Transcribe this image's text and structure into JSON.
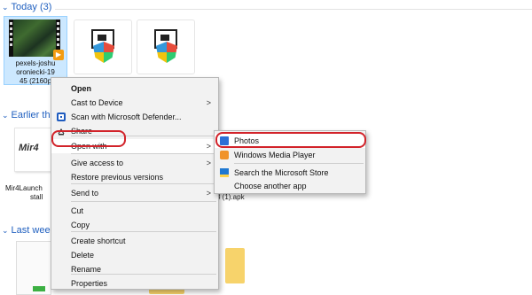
{
  "groups": [
    {
      "label": "Today (3)"
    },
    {
      "label": "Earlier this"
    },
    {
      "label": "Last week"
    }
  ],
  "files": {
    "video": {
      "caption_lines": [
        "pexels-joshu",
        "oroniecki-19",
        "45 (2160p"
      ]
    },
    "installer_caption_tail": "stall",
    "mir4": {
      "caption_lines": [
        "Mir4Launch",
        "stall"
      ],
      "logo_text": "Mir4"
    },
    "apk_suffix": "8 (1).apk"
  },
  "context_menu": {
    "items": [
      {
        "label": "Open",
        "bold": true
      },
      {
        "label": "Cast to Device",
        "arrow": true
      },
      {
        "label": "Scan with Microsoft Defender...",
        "icon": "defender-icon"
      },
      {
        "label": "Share",
        "icon": "share-icon"
      },
      {
        "label": "Open with",
        "arrow": true,
        "hover": true
      },
      {
        "label": "Give access to",
        "arrow": true
      },
      {
        "label": "Restore previous versions"
      },
      {
        "label": "Send to",
        "arrow": true
      },
      {
        "label": "Cut"
      },
      {
        "label": "Copy"
      },
      {
        "label": "Create shortcut"
      },
      {
        "label": "Delete"
      },
      {
        "label": "Rename"
      },
      {
        "label": "Properties"
      }
    ],
    "arrow_glyph": ">"
  },
  "submenu": {
    "items": [
      {
        "label": "Photos",
        "icon": "photos-icon"
      },
      {
        "label": "Windows Media Player",
        "icon": "media-player-icon"
      },
      {
        "label": "Search the Microsoft Store",
        "icon": "store-icon"
      },
      {
        "label": "Choose another app"
      }
    ]
  },
  "colors": {
    "group_header": "#1f5fbf",
    "highlight_ring": "#d2232a",
    "menu_bg": "#f2f2f2",
    "selection": "#cce8ff"
  }
}
